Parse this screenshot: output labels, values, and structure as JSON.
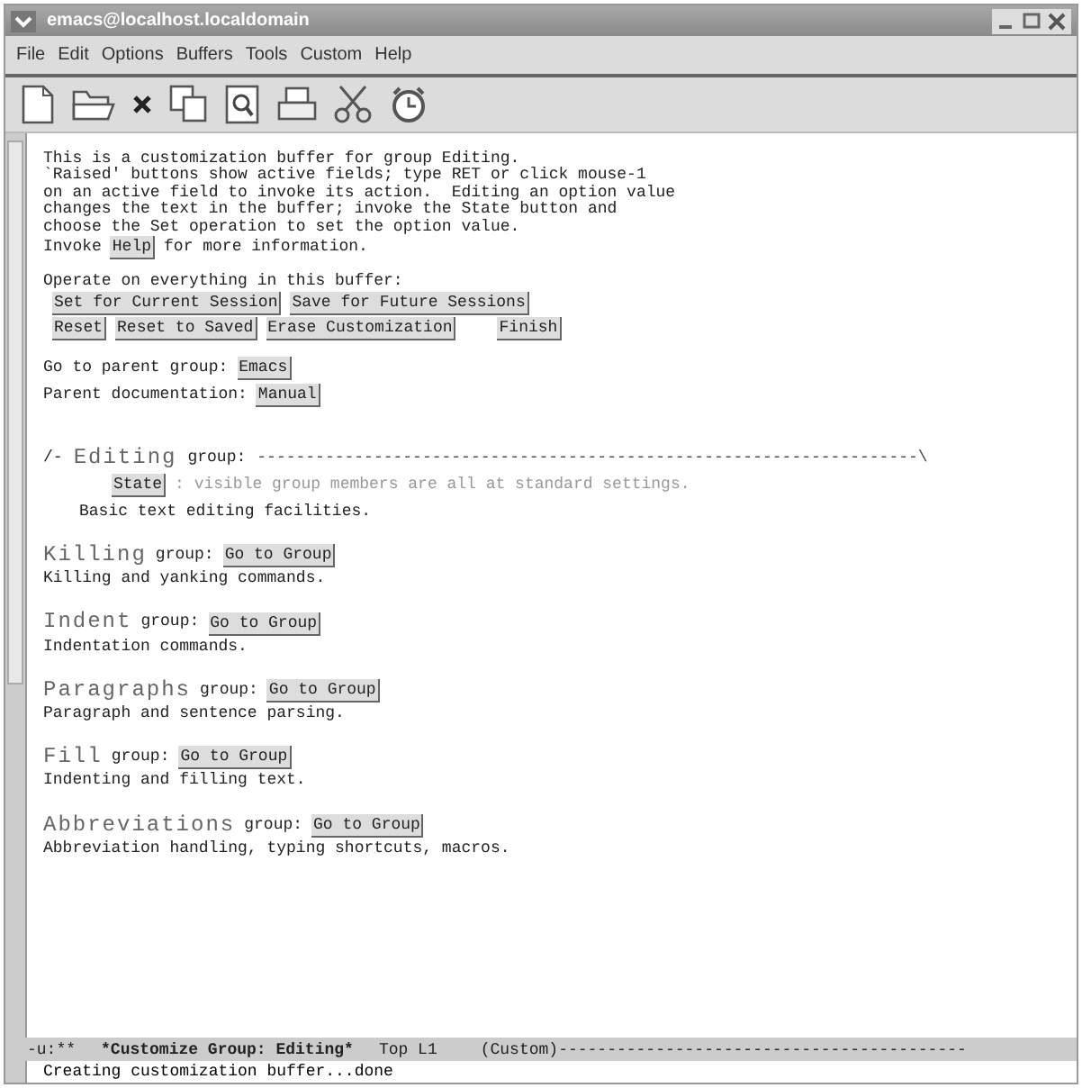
{
  "window": {
    "title": "emacs@localhost.localdomain"
  },
  "menu": [
    "File",
    "Edit",
    "Options",
    "Buffers",
    "Tools",
    "Custom",
    "Help"
  ],
  "buffer": {
    "intro": [
      "This is a customization buffer for group Editing.",
      "`Raised' buttons show active fields; type RET or click mouse-1",
      "on an active field to invoke its action.  Editing an option value",
      "changes the text in the buffer; invoke the State button and",
      "choose the Set operation to set the option value."
    ],
    "help_line": {
      "before": "Invoke",
      "button": "Help",
      "after": "for more information."
    },
    "operate_label": "Operate on everything in this buffer:",
    "button_rows": [
      [
        "Set for Current Session",
        "Save for Future Sessions"
      ],
      [
        "Reset",
        "Reset to Saved",
        "Erase Customization",
        "Finish"
      ]
    ],
    "parent_group": {
      "label": "Go to parent group:",
      "button": "Emacs"
    },
    "parent_doc": {
      "label": "Parent documentation:",
      "button": "Manual"
    },
    "group": {
      "prefix": "/-",
      "name": "Editing",
      "suffix": "group:",
      "rule": "--------------------------------------------------------------------\\",
      "state_button": "State",
      "state_text": ": visible group members are all at standard settings.",
      "description": "Basic text editing facilities."
    },
    "subgroups": [
      {
        "name": "Killing",
        "suffix": "group:",
        "button": "Go to Group",
        "description": "Killing and yanking commands."
      },
      {
        "name": "Indent",
        "suffix": "group:",
        "button": "Go to Group",
        "description": "Indentation commands."
      },
      {
        "name": "Paragraphs",
        "suffix": "group:",
        "button": "Go to Group",
        "description": "Paragraph and sentence parsing."
      },
      {
        "name": "Fill",
        "suffix": "group:",
        "button": "Go to Group",
        "description": "Indenting and filling text."
      },
      {
        "name": "Abbreviations",
        "suffix": "group:",
        "button": "Go to Group",
        "description": "Abbreviation handling, typing shortcuts, macros."
      }
    ]
  },
  "mode_line": {
    "flags": "-u:**",
    "buffer": "*Customize Group: Editing*",
    "position": "Top L1",
    "mode": "(Custom)",
    "rule": "------------------------------------------"
  },
  "echo": "Creating customization buffer...done"
}
